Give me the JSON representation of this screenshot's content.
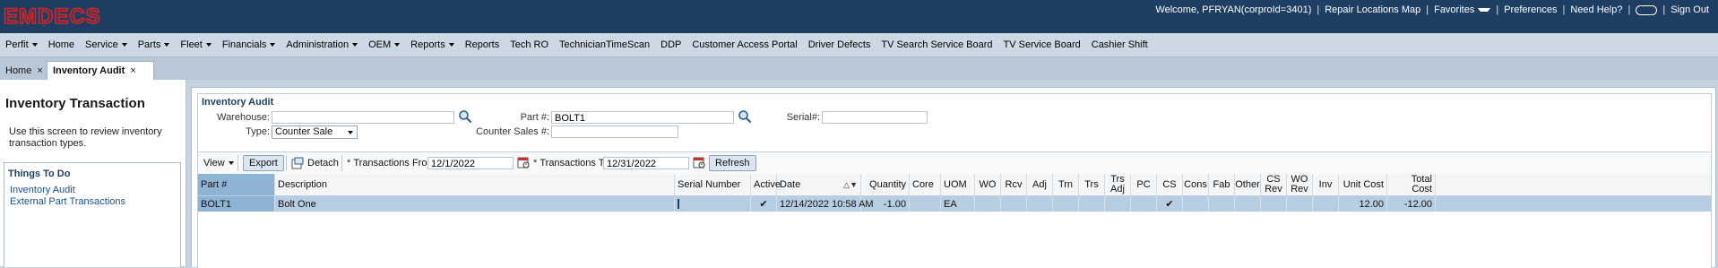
{
  "brand": {
    "logo_text": "EMDECS",
    "logo_color": "#e02020"
  },
  "topbar": {
    "welcome": "Welcome, PFRYAN(corproId=3401)",
    "repair_map": "Repair Locations Map",
    "favorites": "Favorites",
    "preferences": "Preferences",
    "help": "Need Help?",
    "signout": "Sign Out"
  },
  "menu": [
    "Perfit",
    "Home",
    "Service",
    "Parts",
    "Fleet",
    "Financials",
    "Administration",
    "OEM",
    "Reports",
    "Reports",
    "Tech RO",
    "TechnicianTimeScan",
    "DDP",
    "Customer Access Portal",
    "Driver Defects",
    "TV Search Service Board",
    "TV Service Board",
    "Cashier Shift"
  ],
  "tabs": {
    "home": "Home",
    "active": "Inventory Audit"
  },
  "left": {
    "title": "Inventory Transaction",
    "description": "Use this screen to review inventory transaction types.",
    "todo_title": "Things To Do",
    "link1": "Inventory Audit",
    "link2": "External Part Transactions"
  },
  "form": {
    "title": "Inventory Audit",
    "warehouse_label": "Warehouse:",
    "warehouse_value": "",
    "part_label": "Part #:",
    "part_value": "BOLT1",
    "serial_label": "Serial#:",
    "serial_value": "",
    "type_label": "Type:",
    "type_value": "Counter Sale",
    "counter_label": "Counter Sales #:",
    "counter_value": ""
  },
  "toolbar": {
    "view": "View",
    "export": "Export",
    "detach": "Detach",
    "from_label": "Transactions From:",
    "from_value": "12/1/2022",
    "to_label": "Transactions To:",
    "to_value": "12/31/2022",
    "refresh": "Refresh",
    "required_mark": "*"
  },
  "table": {
    "headers": [
      "Part #",
      "Description",
      "Serial Number",
      "Active",
      "Date",
      "Quantity",
      "Core",
      "UOM",
      "WO",
      "Rcv",
      "Adj",
      "Trn",
      "Trs",
      "Trs Adj",
      "PC",
      "CS",
      "Cons",
      "Fab",
      "Other",
      "CS Rev",
      "WO Rev",
      "Inv",
      "Unit Cost",
      "Total Cost"
    ],
    "rows": [
      [
        "BOLT1",
        "Bolt One",
        "",
        "✔",
        "12/14/2022 10:58 AM",
        "-1.00",
        "",
        "EA",
        "",
        "",
        "",
        "",
        "",
        "",
        "",
        "✔",
        "",
        "",
        "",
        "",
        "",
        "",
        "12.00",
        "-12.00"
      ]
    ]
  },
  "colors": {
    "header_bg": "#1e3f63",
    "row_selected": "#b7cde2",
    "accent": "#1a4f8a"
  },
  "icons": [
    "search-icon",
    "calendar-icon",
    "detach-icon",
    "close-icon",
    "chevron-down-icon",
    "sort-icon",
    "chat-icon"
  ]
}
